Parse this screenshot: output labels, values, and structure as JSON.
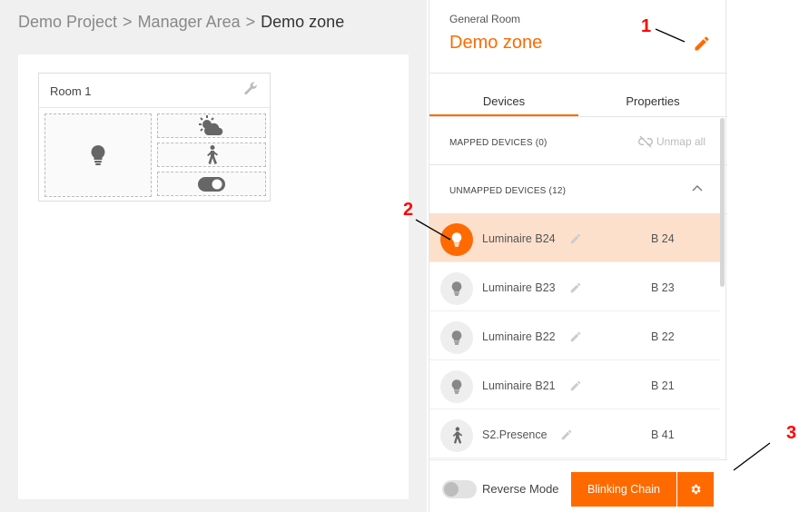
{
  "breadcrumb": {
    "items": [
      "Demo Project",
      "Manager Area"
    ],
    "current": "Demo zone",
    "separator": ">"
  },
  "room": {
    "title": "Room 1",
    "slots": [
      "lightbulb-icon",
      "weather-icon",
      "presence-icon",
      "toggle-switch-icon"
    ]
  },
  "panel": {
    "subtitle": "General Room",
    "title": "Demo zone",
    "tabs": [
      {
        "label": "Devices",
        "active": true
      },
      {
        "label": "Properties",
        "active": false
      }
    ],
    "mapped": {
      "label": "MAPPED DEVICES (0)",
      "unmap_all": "Unmap all"
    },
    "unmapped": {
      "label": "UNMAPPED DEVICES (12)"
    },
    "devices": [
      {
        "name": "Luminaire B24",
        "code": "B 24",
        "icon": "lightbulb-icon",
        "selected": true
      },
      {
        "name": "Luminaire B23",
        "code": "B 23",
        "icon": "lightbulb-icon",
        "selected": false
      },
      {
        "name": "Luminaire B22",
        "code": "B 22",
        "icon": "lightbulb-icon",
        "selected": false
      },
      {
        "name": "Luminaire B21",
        "code": "B 21",
        "icon": "lightbulb-icon",
        "selected": false
      },
      {
        "name": "S2.Presence",
        "code": "B 41",
        "icon": "presence-icon",
        "selected": false
      }
    ],
    "footer": {
      "reverse_label": "Reverse Mode",
      "reverse_on": false,
      "blink_label": "Blinking Chain"
    }
  },
  "annotations": [
    "1",
    "2",
    "3"
  ],
  "colors": {
    "accent": "#ff6a00",
    "selected_row": "#fde0cc",
    "annotation": "#ff0000"
  }
}
